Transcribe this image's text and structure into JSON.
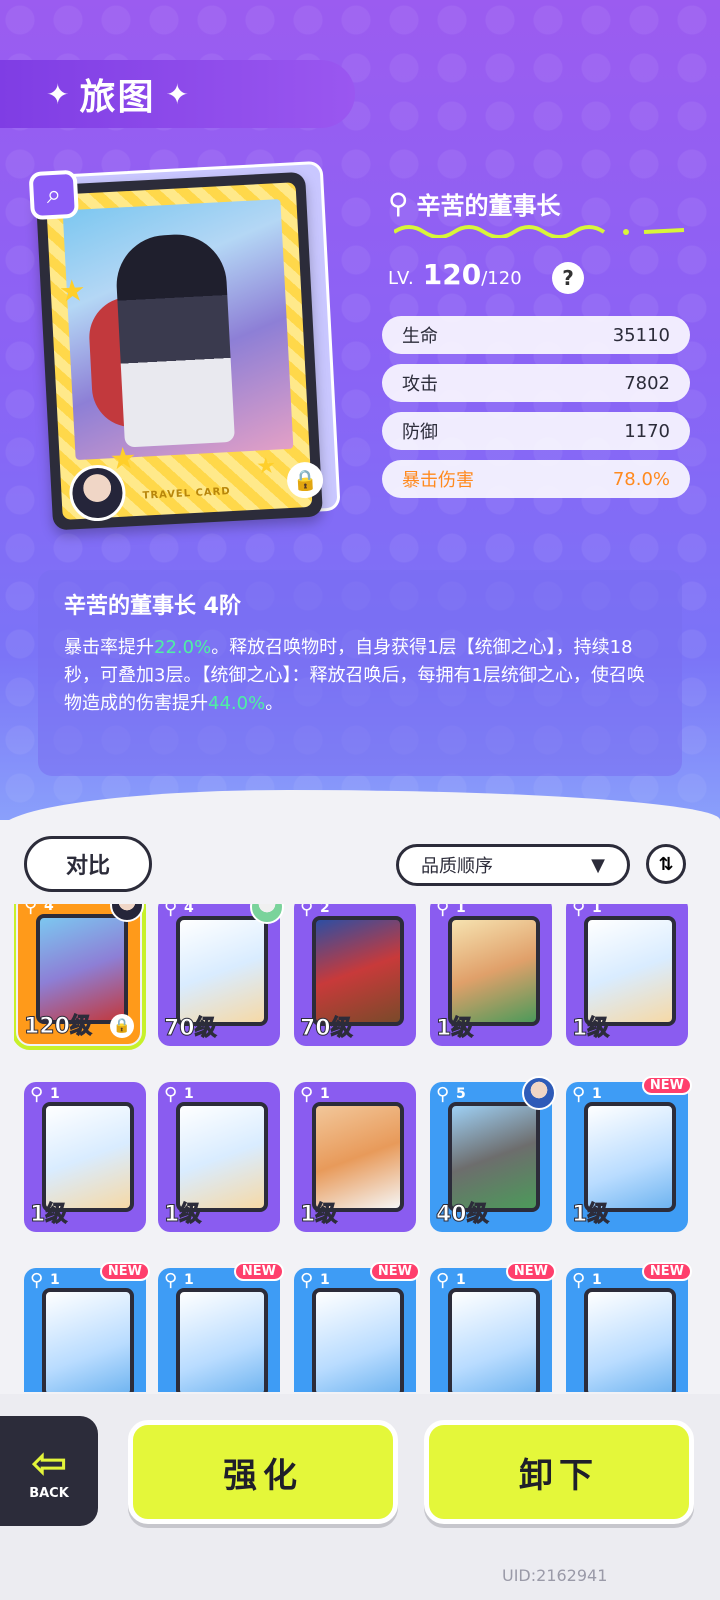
{
  "header": {
    "title": "旅图"
  },
  "card": {
    "label": "TRAVEL CARD"
  },
  "stats": {
    "name": "辛苦的董事长",
    "level_label": "LV.",
    "level_current": "120",
    "level_max": "/120",
    "rows": [
      {
        "label": "生命",
        "value": "35110"
      },
      {
        "label": "攻击",
        "value": "7802"
      },
      {
        "label": "防御",
        "value": "1170"
      },
      {
        "label": "暴击伤害",
        "value": "78.0%"
      }
    ]
  },
  "description": {
    "title": "辛苦的董事长 4阶",
    "part1": "暴击率提升",
    "hl1": "22.0%",
    "part2": "。释放召唤物时，自身获得1层【统御之心】，持续18秒，可叠加3层。【统御之心】：释放召唤后，每拥有1层统御之心，使召唤物造成的伤害提升",
    "hl2": "44.0%",
    "part3": "。"
  },
  "controls": {
    "compare_label": "对比",
    "sort_label": "品质顺序"
  },
  "tiles": [
    {
      "level": "120级",
      "stars": "4"
    },
    {
      "level": "70级",
      "stars": "4"
    },
    {
      "level": "70级",
      "stars": "2"
    },
    {
      "level": "1级",
      "stars": "1"
    },
    {
      "level": "1级",
      "stars": "1"
    },
    {
      "level": "1级",
      "stars": "1"
    },
    {
      "level": "1级",
      "stars": "1"
    },
    {
      "level": "1级",
      "stars": "1"
    },
    {
      "level": "40级",
      "stars": "5"
    },
    {
      "level": "1级",
      "stars": "1",
      "badge": "NEW"
    },
    {
      "stars": "1",
      "badge": "NEW"
    },
    {
      "stars": "1",
      "badge": "NEW"
    },
    {
      "stars": "1",
      "badge": "NEW"
    },
    {
      "stars": "1",
      "badge": "NEW"
    },
    {
      "stars": "1",
      "badge": "NEW"
    }
  ],
  "bottom": {
    "back_label": "BACK",
    "enhance_label": "强化",
    "unequip_label": "卸下",
    "uid": "UID:2162941"
  },
  "colors": {
    "accent_purple": "#8a5cf0",
    "accent_blue": "#3e9cf5",
    "accent_lime": "#e4f73a",
    "highlight_green": "#4ef0a3",
    "crit_orange": "#ff8a1f"
  }
}
